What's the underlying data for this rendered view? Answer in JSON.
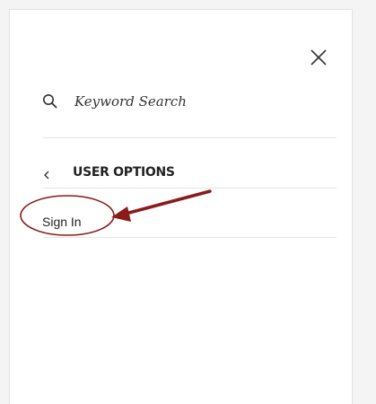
{
  "search": {
    "placeholder": "Keyword Search"
  },
  "menu": {
    "section_title": "USER OPTIONS",
    "items": [
      {
        "label": "Sign In"
      }
    ]
  },
  "icons": {
    "close": "close-icon",
    "search": "search-icon",
    "back": "chevron-left-icon"
  },
  "colors": {
    "annotation": "#8b1a1a",
    "text": "#222222",
    "divider": "#e5e5e5"
  }
}
